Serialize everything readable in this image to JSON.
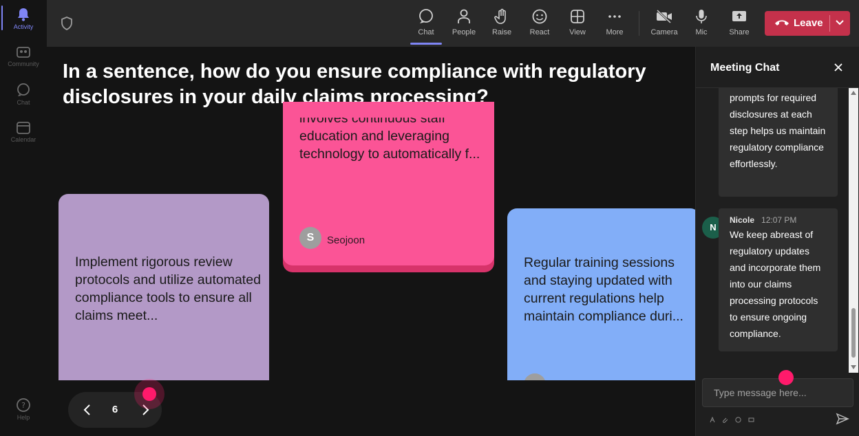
{
  "sidebar": {
    "items": [
      {
        "label": "Activity",
        "icon": "bell-icon",
        "active": true
      },
      {
        "label": "Community",
        "icon": "community-icon"
      },
      {
        "label": "Chat",
        "icon": "chat-icon"
      },
      {
        "label": "Calendar",
        "icon": "calendar-icon"
      }
    ],
    "help": {
      "label": "Help",
      "icon": "help-icon"
    }
  },
  "toolbar": {
    "buttons": [
      {
        "label": "Chat",
        "icon": "chat-icon",
        "active": true
      },
      {
        "label": "People",
        "icon": "people-icon"
      },
      {
        "label": "Raise",
        "icon": "raise-hand-icon"
      },
      {
        "label": "React",
        "icon": "react-icon"
      },
      {
        "label": "View",
        "icon": "view-grid-icon"
      },
      {
        "label": "More",
        "icon": "more-icon"
      },
      {
        "label": "Camera",
        "icon": "camera-off-icon"
      },
      {
        "label": "Mic",
        "icon": "mic-icon"
      },
      {
        "label": "Share",
        "icon": "share-icon"
      }
    ],
    "leave_label": "Leave"
  },
  "stage": {
    "question": "In a sentence, how do you ensure compliance with regulatory disclosures in your daily claims processing?",
    "cards": [
      {
        "text": "Implement rigorous review protocols and utilize automated compliance tools to ensure all claims meet...",
        "color": "#b399c7"
      },
      {
        "text_first_line": "involves continuous staff",
        "text": "education and leveraging technology to automatically f...",
        "author": "Seojoon",
        "author_initial": "S",
        "color": "#fb5496"
      },
      {
        "text": "Regular training sessions and staying updated with current regulations help maintain compliance duri...",
        "color": "#82aef8"
      }
    ],
    "pager": {
      "current": "6"
    }
  },
  "chat": {
    "title": "Meeting Chat",
    "messages": [
      {
        "text": "prompts for required disclosures at each step helps us maintain regulatory compliance effortlessly."
      },
      {
        "author": "Nicole",
        "author_initial": "N",
        "time": "12:07 PM",
        "text": "We keep abreast of regulatory updates and incorporate them into our claims processing protocols to ensure ongoing compliance."
      }
    ],
    "input_placeholder": "Type message here..."
  },
  "colors": {
    "accent": "#7f85f5",
    "leave": "#c4314b",
    "cursor": "#ff1a6b"
  }
}
